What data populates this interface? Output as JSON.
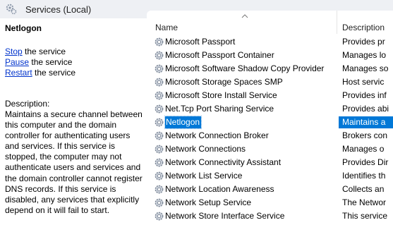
{
  "window": {
    "title": "Services (Local)"
  },
  "details": {
    "service_name": "Netlogon",
    "actions": [
      {
        "link": "Stop",
        "rest": " the service"
      },
      {
        "link": "Pause",
        "rest": " the service"
      },
      {
        "link": "Restart",
        "rest": " the service"
      }
    ],
    "description_heading": "Description:",
    "description": "Maintains a secure channel between this computer and the domain controller for authenticating users and services. If this service is stopped, the computer may not authenticate users and services and the domain controller cannot register DNS records. If this service is disabled, any services that explicitly depend on it will fail to start."
  },
  "list": {
    "columns": {
      "name": "Name",
      "description": "Description"
    },
    "rows": [
      {
        "name": "Microsoft Passport",
        "description": "Provides pr"
      },
      {
        "name": "Microsoft Passport Container",
        "description": "Manages lo"
      },
      {
        "name": "Microsoft Software Shadow Copy Provider",
        "description": "Manages so"
      },
      {
        "name": "Microsoft Storage Spaces SMP",
        "description": "Host servic"
      },
      {
        "name": "Microsoft Store Install Service",
        "description": "Provides inf"
      },
      {
        "name": "Net.Tcp Port Sharing Service",
        "description": "Provides abi"
      },
      {
        "name": "Netlogon",
        "description": "Maintains a",
        "selected": true
      },
      {
        "name": "Network Connection Broker",
        "description": "Brokers con"
      },
      {
        "name": "Network Connections",
        "description": "Manages o"
      },
      {
        "name": "Network Connectivity Assistant",
        "description": "Provides Dir"
      },
      {
        "name": "Network List Service",
        "description": "Identifies th"
      },
      {
        "name": "Network Location Awareness",
        "description": "Collects an"
      },
      {
        "name": "Network Setup Service",
        "description": "The Networ"
      },
      {
        "name": "Network Store Interface Service",
        "description": "This service"
      }
    ]
  }
}
